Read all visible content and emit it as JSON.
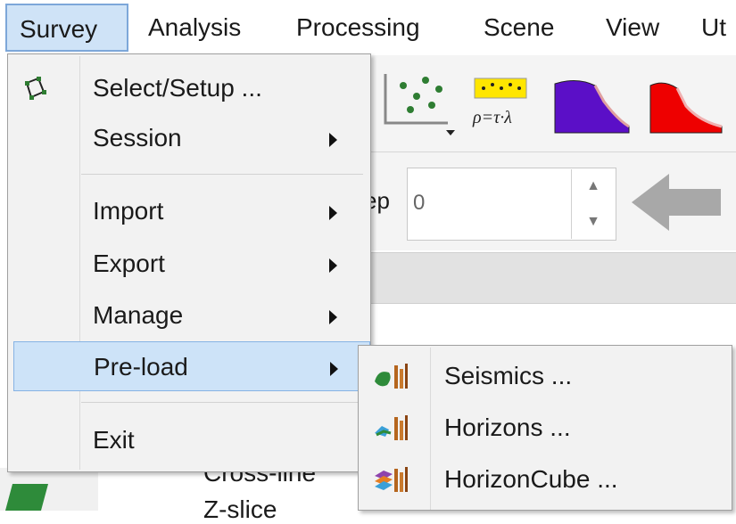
{
  "menubar": {
    "items": [
      {
        "label": "Survey",
        "active": true
      },
      {
        "label": "Analysis"
      },
      {
        "label": "Processing"
      },
      {
        "label": "Scene"
      },
      {
        "label": "View"
      },
      {
        "label": "Ut"
      }
    ]
  },
  "toolbar": {
    "formula_label": "ρ=τ·λ",
    "step_label": "ep",
    "step_value": "0"
  },
  "tree": {
    "items": [
      "Cross-line",
      "Z-slice"
    ]
  },
  "survey_menu": {
    "items": [
      {
        "label": "Select/Setup ...",
        "icon": "survey-setup-icon"
      },
      {
        "label": "Session",
        "submenu": true
      },
      {
        "label": "Import",
        "submenu": true
      },
      {
        "label": "Export",
        "submenu": true
      },
      {
        "label": "Manage",
        "submenu": true
      },
      {
        "label": "Pre-load",
        "submenu": true,
        "highlighted": true
      },
      {
        "label": "Exit"
      }
    ]
  },
  "preload_submenu": {
    "items": [
      {
        "label": "Seismics ...",
        "icon": "seismics-icon"
      },
      {
        "label": "Horizons ...",
        "icon": "horizons-icon"
      },
      {
        "label": "HorizonCube ...",
        "icon": "horizoncube-icon"
      }
    ]
  },
  "colors": {
    "highlight": "#cde3f8",
    "highlight_border": "#86b3e4",
    "menu_bg": "#f2f2f2"
  }
}
